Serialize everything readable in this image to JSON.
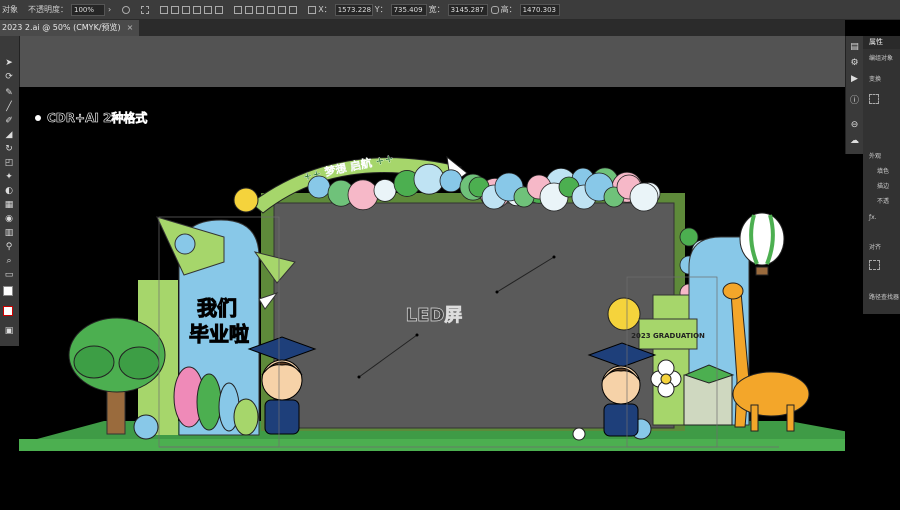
{
  "control_bar": {
    "object_label": "对象",
    "opacity_label": "不透明度：",
    "opacity_value": "100%",
    "x_label": "X：",
    "x_value": "1573.228",
    "y_label": "Y：",
    "y_value": "735.409",
    "width_label": "宽：",
    "width_value": "3145.287",
    "height_label": "高：",
    "height_value": "1470.303"
  },
  "document_tab": {
    "title": "2023 2.ai @ 50% (CMYK/预览)",
    "close": "×"
  },
  "properties_panel": {
    "tab": "属性",
    "group_label": "编组对象",
    "transform_label": "变换",
    "appearance_label": "外观",
    "fill_label": "填色",
    "stroke_label": "描边",
    "opacity_label": "不透",
    "align_label": "对齐",
    "path_label": "路径查找器"
  },
  "artwork": {
    "note": "CDR+AI 2种格式",
    "led_label": "LED屏",
    "title_line1": "我们",
    "title_line2": "毕业啦",
    "arch_banner": "++ 梦想 启航 ++",
    "sign_text": "2023 GRADUATION"
  },
  "colors": {
    "stage_green": "#4caf50",
    "light_blue": "#88c8e8",
    "light_green": "#a6d66b",
    "screen_gray": "#5a5a5a",
    "pasteboard": "#535353"
  }
}
